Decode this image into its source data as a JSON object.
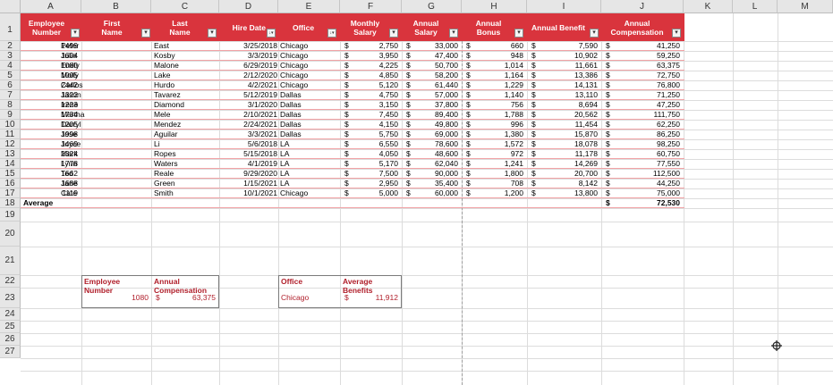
{
  "columns": [
    "A",
    "B",
    "C",
    "D",
    "E",
    "F",
    "G",
    "H",
    "I",
    "J",
    "K",
    "L",
    "M"
  ],
  "rows": [
    "1",
    "2",
    "3",
    "4",
    "5",
    "6",
    "7",
    "8",
    "9",
    "10",
    "11",
    "12",
    "13",
    "14",
    "15",
    "16",
    "17",
    "18",
    "19",
    "20",
    "21",
    "22",
    "23",
    "24",
    "25",
    "26",
    "27"
  ],
  "table": {
    "headers": {
      "emp_num": [
        "Employee",
        "Number"
      ],
      "first": [
        "First",
        "Name"
      ],
      "last": [
        "Last",
        "Name"
      ],
      "hire": [
        "Hire Date"
      ],
      "office": [
        "Office"
      ],
      "monthly": [
        "Monthly",
        "Salary"
      ],
      "annual_salary": [
        "Annual",
        "Salary"
      ],
      "annual_bonus": [
        "Annual",
        "Bonus"
      ],
      "annual_benefit": [
        "Annual Benefit"
      ],
      "annual_comp": [
        "Annual",
        "Compensation"
      ]
    },
    "currency_symbol": "$",
    "records": [
      [
        "1499",
        "Peter",
        "East",
        "3/25/2018",
        "Chicago",
        "2,750",
        "33,000",
        "660",
        "7,590",
        "41,250"
      ],
      [
        "1604",
        "Julie",
        "Kosby",
        "3/3/2019",
        "Chicago",
        "3,950",
        "47,400",
        "948",
        "10,902",
        "59,250"
      ],
      [
        "1080",
        "Emily",
        "Malone",
        "6/29/2019",
        "Chicago",
        "4,225",
        "50,700",
        "1,014",
        "11,661",
        "63,375"
      ],
      [
        "1005",
        "Molly",
        "Lake",
        "2/12/2020",
        "Chicago",
        "4,850",
        "58,200",
        "1,164",
        "13,386",
        "72,750"
      ],
      [
        "2442",
        "Carlos",
        "Hurdo",
        "4/2/2021",
        "Chicago",
        "5,120",
        "61,440",
        "1,229",
        "14,131",
        "76,800"
      ],
      [
        "1322",
        "Jason",
        "Tavarez",
        "5/12/2019",
        "Dallas",
        "4,750",
        "57,000",
        "1,140",
        "13,110",
        "71,250"
      ],
      [
        "1223",
        "Irene",
        "Diamond",
        "3/1/2020",
        "Dallas",
        "3,150",
        "37,800",
        "756",
        "8,694",
        "47,250"
      ],
      [
        "1734",
        "Martha",
        "Mele",
        "2/10/2021",
        "Dallas",
        "7,450",
        "89,400",
        "1,788",
        "20,562",
        "111,750"
      ],
      [
        "1205",
        "Darryl",
        "Mendez",
        "2/24/2021",
        "Dallas",
        "4,150",
        "49,800",
        "996",
        "11,454",
        "62,250"
      ],
      [
        "1998",
        "Jose",
        "Aguilar",
        "3/3/2021",
        "Dallas",
        "5,750",
        "69,000",
        "1,380",
        "15,870",
        "86,250"
      ],
      [
        "1469",
        "Joyce",
        "Li",
        "5/6/2018",
        "LA",
        "6,550",
        "78,600",
        "1,572",
        "18,078",
        "98,250"
      ],
      [
        "2324",
        "Mark",
        "Ropes",
        "5/15/2018",
        "LA",
        "4,050",
        "48,600",
        "972",
        "11,178",
        "60,750"
      ],
      [
        "1778",
        "Lynn",
        "Waters",
        "4/1/2019",
        "LA",
        "5,170",
        "62,040",
        "1,241",
        "14,269",
        "77,550"
      ],
      [
        "1662",
        "Ted",
        "Reale",
        "9/29/2020",
        "LA",
        "7,500",
        "90,000",
        "1,800",
        "20,700",
        "112,500"
      ],
      [
        "1688",
        "Jane",
        "Green",
        "1/15/2021",
        "LA",
        "2,950",
        "35,400",
        "708",
        "8,142",
        "44,250"
      ],
      [
        "1119",
        "Cate",
        "Smith",
        "10/1/2021",
        "Chicago",
        "5,000",
        "60,000",
        "1,200",
        "13,800",
        "75,000"
      ]
    ],
    "total_label": "Average",
    "total_value": "72,530"
  },
  "lookup1": {
    "headers": [
      [
        "Employee",
        "Number"
      ],
      [
        "Annual",
        "Compensation"
      ]
    ],
    "number": "1080",
    "value": "63,375"
  },
  "lookup2": {
    "headers": [
      [
        "Office"
      ],
      [
        "Average",
        "Benefits"
      ]
    ],
    "office": "Chicago",
    "value": "11,912"
  },
  "colors": {
    "header_fill": "#d9343d",
    "header_text": "#ffffff",
    "accent_text": "#b01e2a",
    "row_border": "#f2a3a6"
  },
  "icons": {
    "filter": "dropdown-arrow",
    "sort": "sort-arrow",
    "cursor": "cell-select-crosshair"
  }
}
